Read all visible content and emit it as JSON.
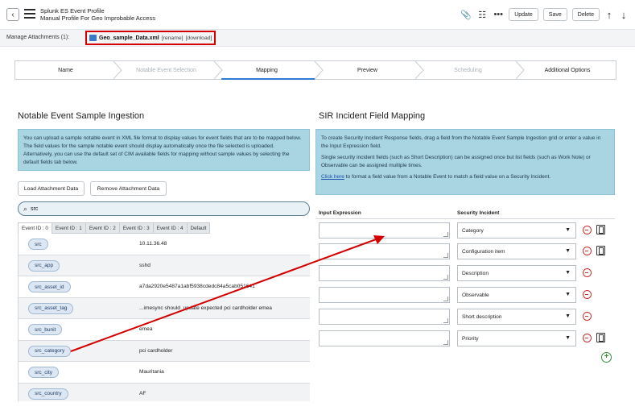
{
  "header": {
    "title": "Splunk ES Event Profile",
    "subtitle": "Manual Profile For Geo Improbable Access",
    "buttons": {
      "update": "Update",
      "save": "Save",
      "delete": "Delete"
    }
  },
  "attachments": {
    "label": "Manage Attachments (1):",
    "file_name": "Geo_sample_Data.xml",
    "rename": "[rename]",
    "download": "[download]"
  },
  "steps": [
    {
      "label": "Name",
      "state": "normal"
    },
    {
      "label": "Notable Event Selection",
      "state": "disabled"
    },
    {
      "label": "Mapping",
      "state": "active"
    },
    {
      "label": "Preview",
      "state": "normal"
    },
    {
      "label": "Scheduling",
      "state": "disabled"
    },
    {
      "label": "Additional Options",
      "state": "normal"
    }
  ],
  "left": {
    "title": "Notable Event Sample Ingestion",
    "info": "You can upload a sample notable event in XML file format to display values for event fields that are to be mapped below. The field values for the sample notable event should display automatically once the file selected is uploaded. Alternatively, you can use the default set of CIM available fields for mapping without sample values by selecting the default fields tab below.",
    "load_button": "Load Attachment Data",
    "remove_button": "Remove Attachment Data",
    "search_value": "src",
    "tabs": [
      "Event ID : 0",
      "Event ID : 1",
      "Event ID : 2",
      "Event ID : 3",
      "Event ID : 4",
      "Default"
    ],
    "rows": [
      {
        "field": "src",
        "value": "10.11.36.48"
      },
      {
        "field": "src_app",
        "value": "sshd"
      },
      {
        "field": "src_asset_id",
        "value": "a7da2920e5487a1abf5938cdedc84a5cab051641"
      },
      {
        "field": "src_asset_tag",
        "value": "...imesync should_update expected pci cardholder emea"
      },
      {
        "field": "src_bunit",
        "value": "emea"
      },
      {
        "field": "src_category",
        "value": "pci cardholder"
      },
      {
        "field": "src_city",
        "value": "Mauritania"
      },
      {
        "field": "src_country",
        "value": "AF"
      }
    ]
  },
  "right": {
    "title": "SIR Incident Field Mapping",
    "info1": "To create Security Incident Response fields, drag a field from the Notable Event Sample Ingestion grid or enter a value in the Input Expression field.",
    "info2": "Single security incident fields (such as Short Description) can be assigned once but list fields (such as Work Note) or Observable can be assigned multiple times.",
    "info_link": "Click here",
    "info3": " to format a field value from a Notable Event to match a field value on a Security Incident.",
    "col_expression": "Input Expression",
    "col_incident": "Security Incident",
    "mappings": [
      {
        "incident": "Category",
        "ref": true
      },
      {
        "incident": "Configuration item",
        "ref": true
      },
      {
        "incident": "Description",
        "ref": false
      },
      {
        "incident": "Observable",
        "ref": false
      },
      {
        "incident": "Short description",
        "ref": false
      },
      {
        "incident": "Priority",
        "ref": true
      }
    ]
  },
  "colors": {
    "accent": "#2e7bd6",
    "info_bg": "#a9d4e2",
    "annotation": "#d40000",
    "remove": "#c9302c",
    "add": "#3a8a3a"
  },
  "icons": [
    "back-icon",
    "menu-icon",
    "paperclip-icon",
    "settings-sliders-icon",
    "more-icon",
    "arrow-up-icon",
    "arrow-down-icon",
    "search-icon",
    "remove-icon",
    "reference-icon",
    "add-icon"
  ]
}
